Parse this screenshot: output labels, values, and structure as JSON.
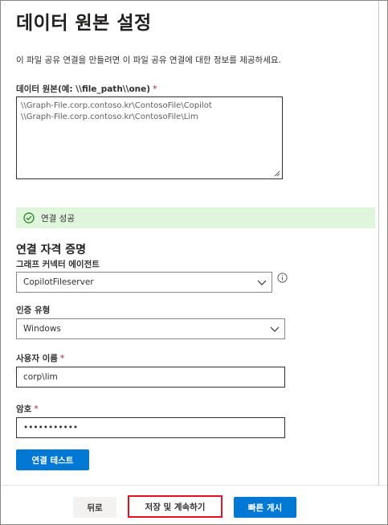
{
  "page": {
    "title": "데이터 원본 설정",
    "description": "이 파일 공유 연결을 만들려면 이 파일 공유 연결에 대한 정보를 제공하세요."
  },
  "data_source": {
    "label": "데이터 원본(예: \\\\file_path\\\\one)",
    "required_mark": "*",
    "lines": [
      "\\\\Graph-File.corp.contoso.kr\\ContosoFile\\Copilot",
      "\\\\Graph-File.corp.contoso.kr\\ContosoFile\\Lim"
    ]
  },
  "status": {
    "text": "연결 성공",
    "icon": "check-circle-icon",
    "color": "#dff6dd"
  },
  "credentials": {
    "title": "연결 자격 증명",
    "agent_label": "그래프 커넥터 에이전트",
    "agent_value": "CopilotFileserver",
    "auth_label": "인증 유형",
    "auth_value": "Windows",
    "username_label": "사용자 이름",
    "username_value": "corp\\lim",
    "password_label": "암호",
    "password_value": "•••••••••••",
    "required_mark": "*"
  },
  "actions": {
    "test_connection": "연결 테스트",
    "back": "뒤로",
    "save_continue": "저장 및 계속하기",
    "quick_publish": "빠른 게시"
  },
  "colors": {
    "accent": "#0078d4",
    "highlight_border": "#e81123",
    "required": "#a4262c"
  }
}
